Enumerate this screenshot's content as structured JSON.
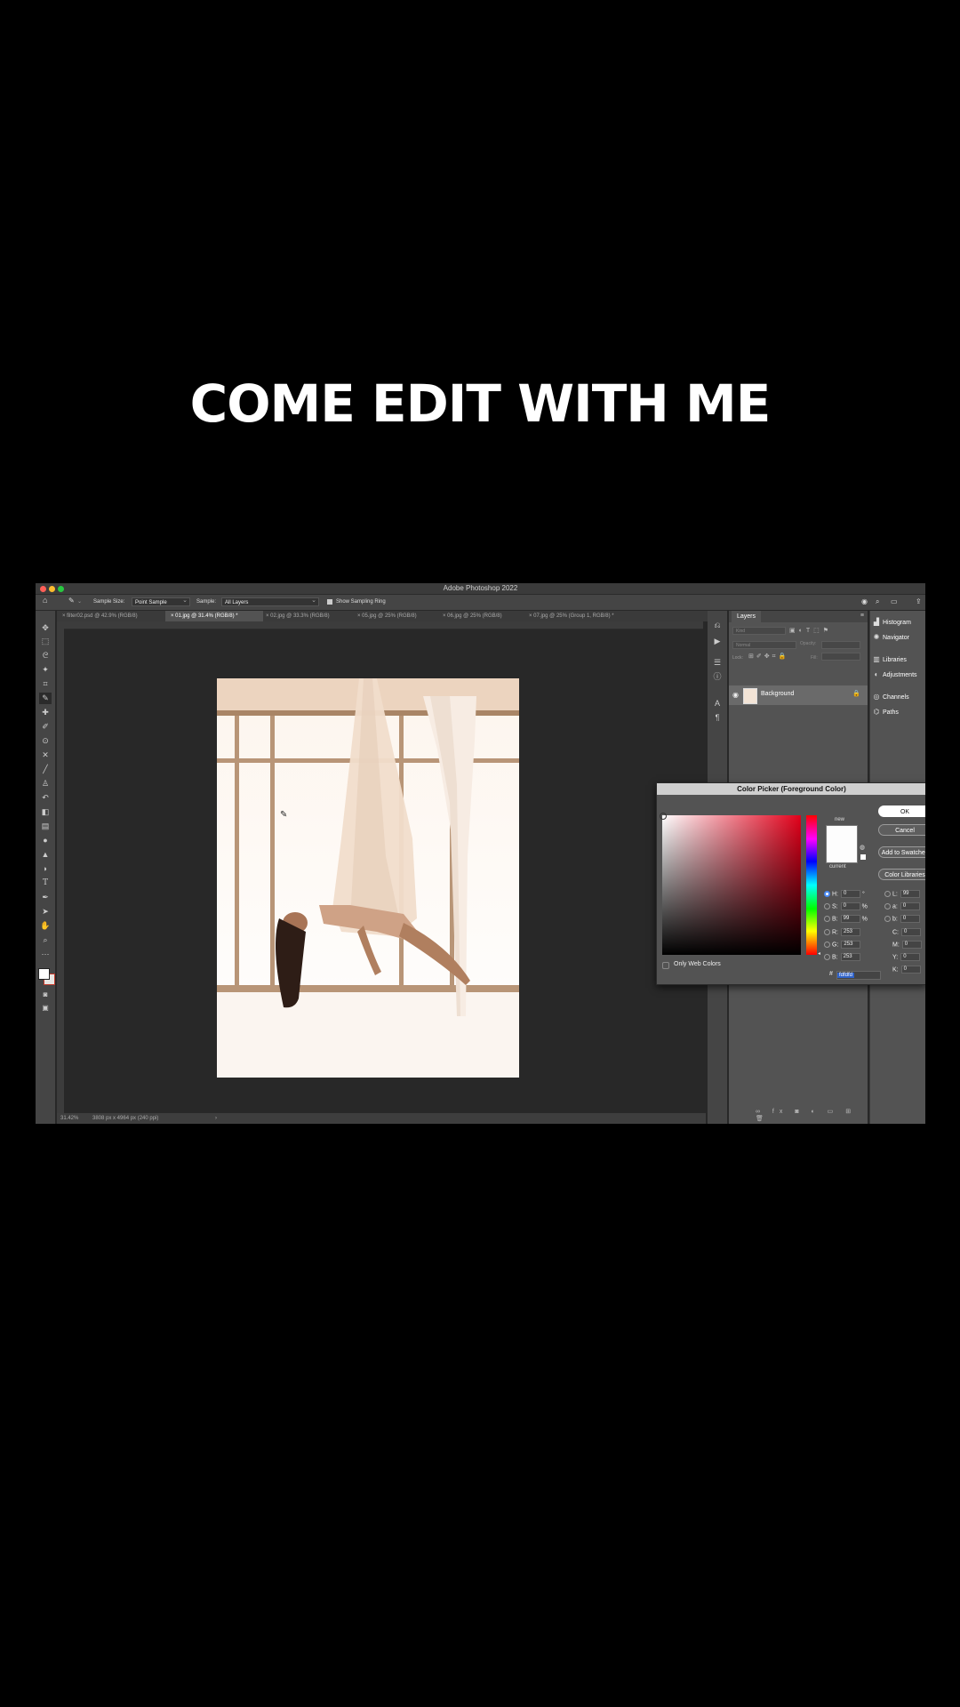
{
  "caption": "COME EDIT WITH ME",
  "window": {
    "title": "Adobe Photoshop 2022",
    "colors": {
      "close": "#ff5f57",
      "minimize": "#febc2e",
      "zoom": "#28c840"
    }
  },
  "options_bar": {
    "sample_size_label": "Sample Size:",
    "sample_size_value": "Point Sample",
    "sample_label": "Sample:",
    "sample_value": "All Layers",
    "show_ring_label": "Show Sampling Ring"
  },
  "tabs": [
    {
      "label": "filter02.psd @ 42.9% (RGB/8)"
    },
    {
      "label": "01.jpg @ 31.4% (RGB/8) *"
    },
    {
      "label": "02.jpg @ 33.3% (RGB/8)"
    },
    {
      "label": "05.jpg @ 25% (RGB/8)"
    },
    {
      "label": "06.jpg @ 25% (RGB/8)"
    },
    {
      "label": "07.jpg @ 25% (Group 1, RGB/8) *"
    }
  ],
  "status": {
    "zoom": "31.42%",
    "info": "3808 px x 4964 px (240 ppi)"
  },
  "layers_panel": {
    "tab": "Layers",
    "search_placeholder": "Kind",
    "blend_mode": "Normal",
    "opacity_label": "Opacity:",
    "lock_label": "Lock:",
    "fill_label": "Fill:",
    "layer_name": "Background"
  },
  "right_panels": [
    {
      "label": "Histogram",
      "icon": "histogram-icon"
    },
    {
      "label": "Navigator",
      "icon": "navigator-icon"
    },
    {
      "label": "Libraries",
      "icon": "libraries-icon"
    },
    {
      "label": "Adjustments",
      "icon": "adjustments-icon"
    },
    {
      "label": "Channels",
      "icon": "channels-icon"
    },
    {
      "label": "Paths",
      "icon": "paths-icon"
    }
  ],
  "color_picker": {
    "title": "Color Picker (Foreground Color)",
    "new_label": "new",
    "current_label": "current",
    "ok": "OK",
    "cancel": "Cancel",
    "add_to_swatches": "Add to Swatches",
    "color_libraries": "Color Libraries",
    "only_web_colors": "Only Web Colors",
    "hsb": [
      {
        "label": "H:",
        "value": "0",
        "unit": "°"
      },
      {
        "label": "S:",
        "value": "0",
        "unit": "%"
      },
      {
        "label": "B:",
        "value": "99",
        "unit": "%"
      }
    ],
    "rgb": [
      {
        "label": "R:",
        "value": "253"
      },
      {
        "label": "G:",
        "value": "253"
      },
      {
        "label": "B:",
        "value": "253"
      }
    ],
    "lab": [
      {
        "label": "L:",
        "value": "99"
      },
      {
        "label": "a:",
        "value": "0"
      },
      {
        "label": "b:",
        "value": "0"
      }
    ],
    "cmyk": [
      {
        "label": "C:",
        "value": "0"
      },
      {
        "label": "M:",
        "value": "0"
      },
      {
        "label": "Y:",
        "value": "0"
      },
      {
        "label": "K:",
        "value": "0"
      }
    ],
    "hex_label": "#",
    "hex": "fdfdfd",
    "new_color": "#fdfdfd"
  }
}
